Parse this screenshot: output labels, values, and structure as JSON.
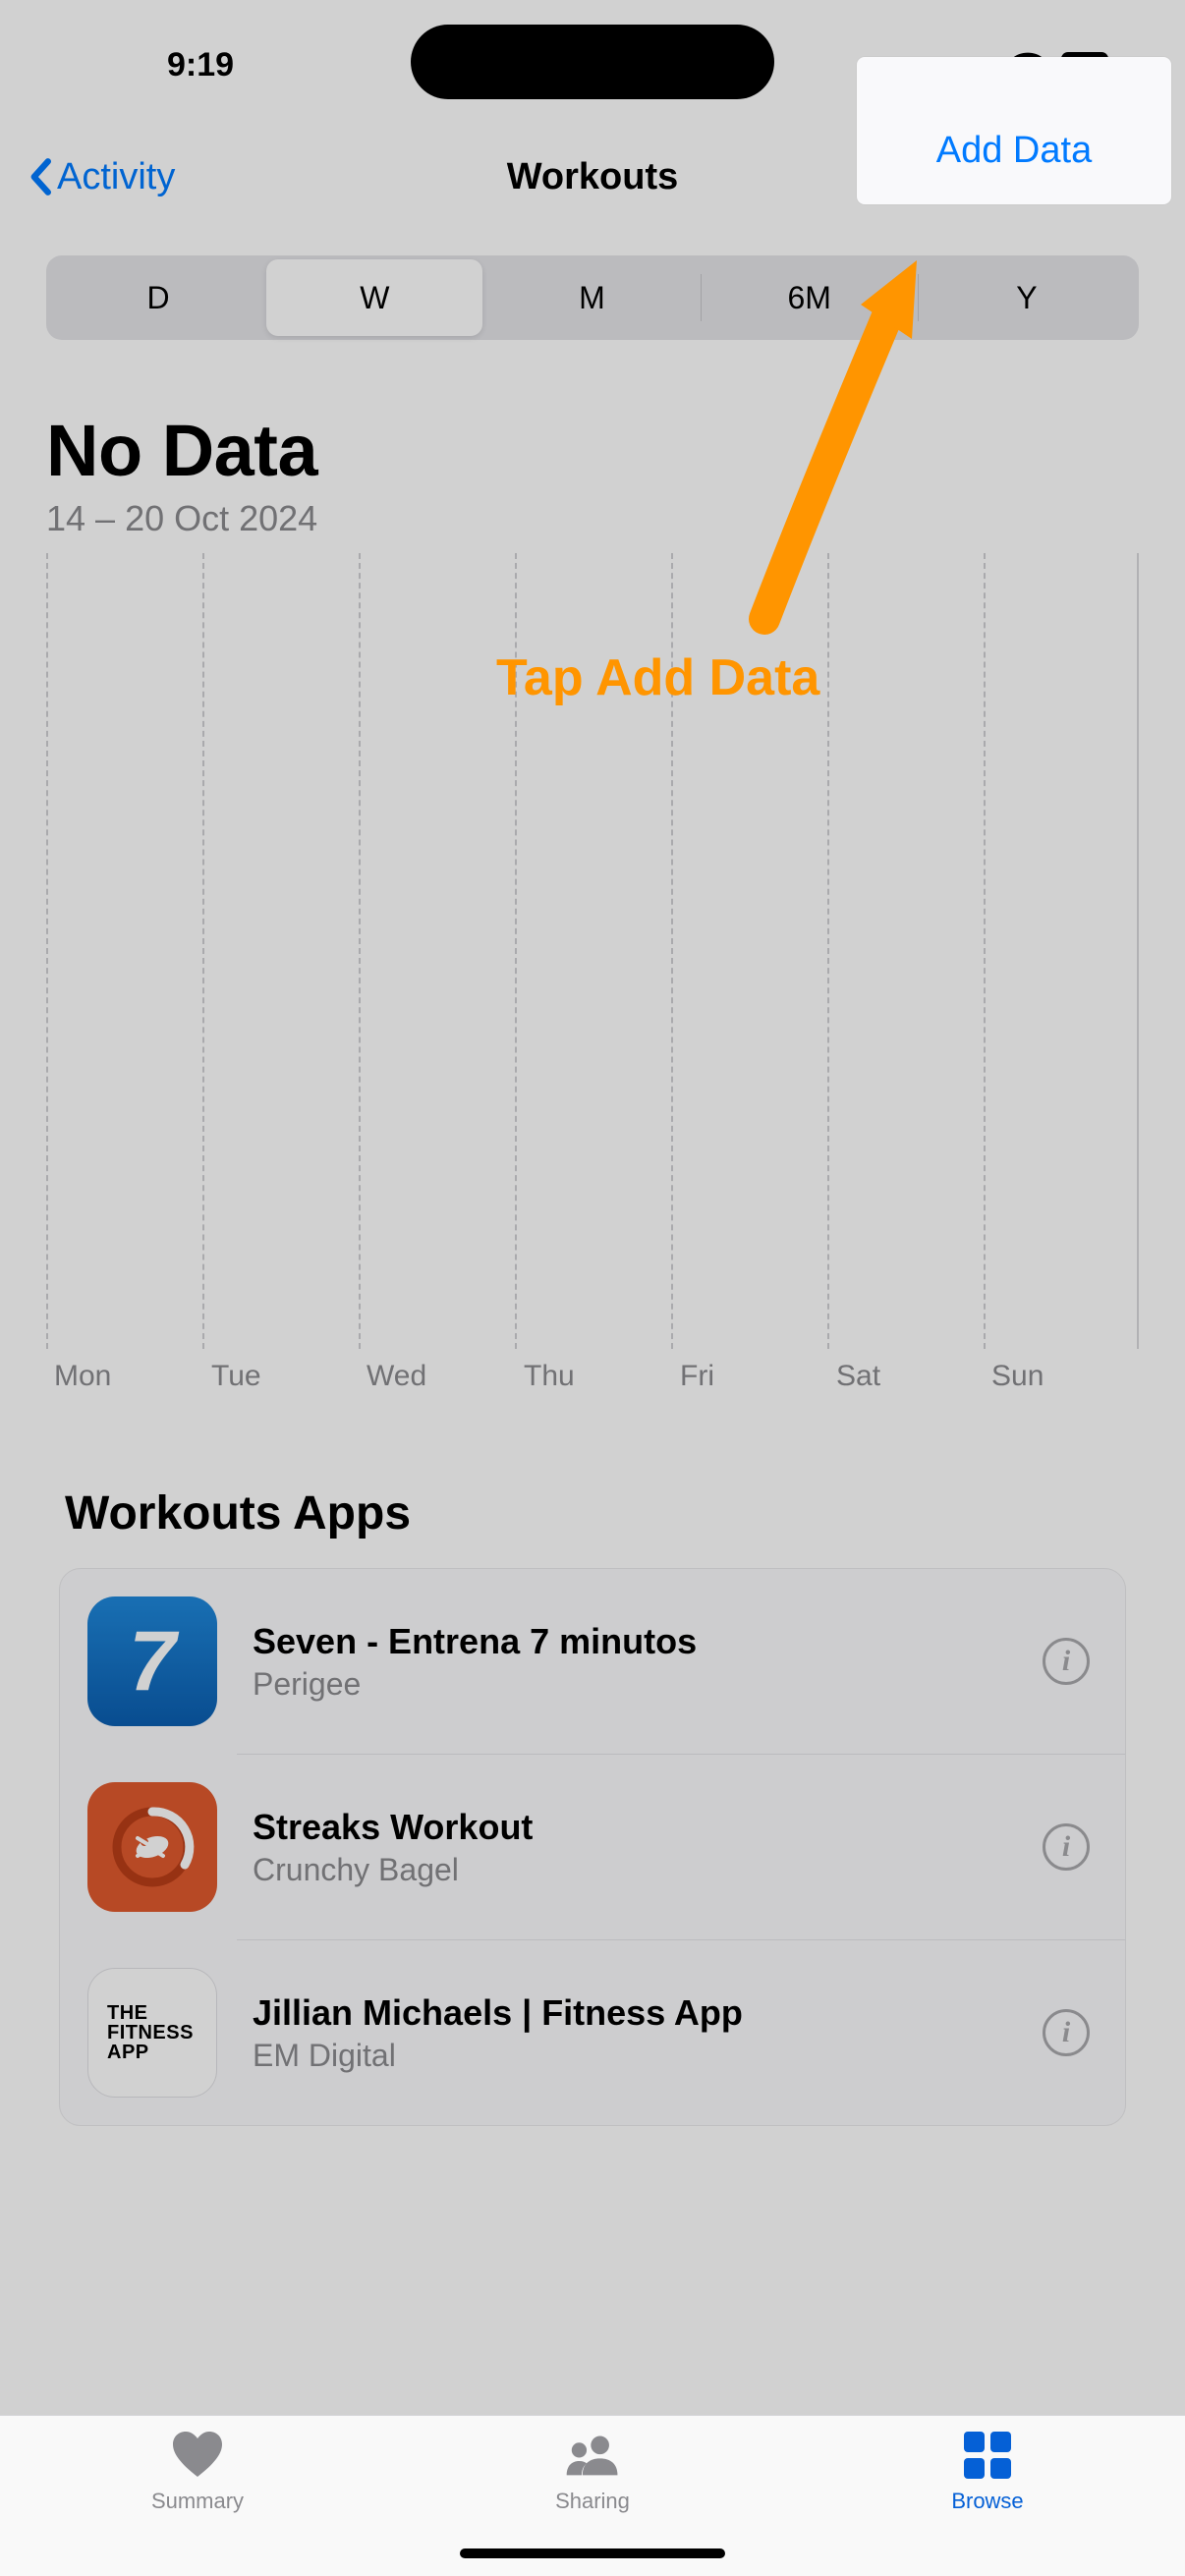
{
  "status": {
    "time": "9:19"
  },
  "nav": {
    "back_label": "Activity",
    "title": "Workouts",
    "add_data_label": "Add Data"
  },
  "segments": [
    "D",
    "W",
    "M",
    "6M",
    "Y"
  ],
  "segments_selected_index": 1,
  "summary": {
    "title": "No Data",
    "date_range": "14 – 20 Oct 2024"
  },
  "chart": {
    "days": [
      "Mon",
      "Tue",
      "Wed",
      "Thu",
      "Fri",
      "Sat",
      "Sun"
    ]
  },
  "annotation": {
    "text": "Tap Add Data"
  },
  "apps_section": {
    "heading": "Workouts Apps",
    "items": [
      {
        "title": "Seven - Entrena 7 minutos",
        "subtitle": "Perigee",
        "icon_text": "7"
      },
      {
        "title": "Streaks Workout",
        "subtitle": "Crunchy Bagel"
      },
      {
        "title": "Jillian Michaels | Fitness App",
        "subtitle": "EM Digital",
        "icon_lines": [
          "THE",
          "FITNESS",
          "APP"
        ]
      }
    ]
  },
  "tabs": {
    "items": [
      {
        "label": "Summary"
      },
      {
        "label": "Sharing"
      },
      {
        "label": "Browse"
      }
    ],
    "active_index": 2
  },
  "colors": {
    "accent": "#007aff",
    "annotation": "#ff9500"
  }
}
